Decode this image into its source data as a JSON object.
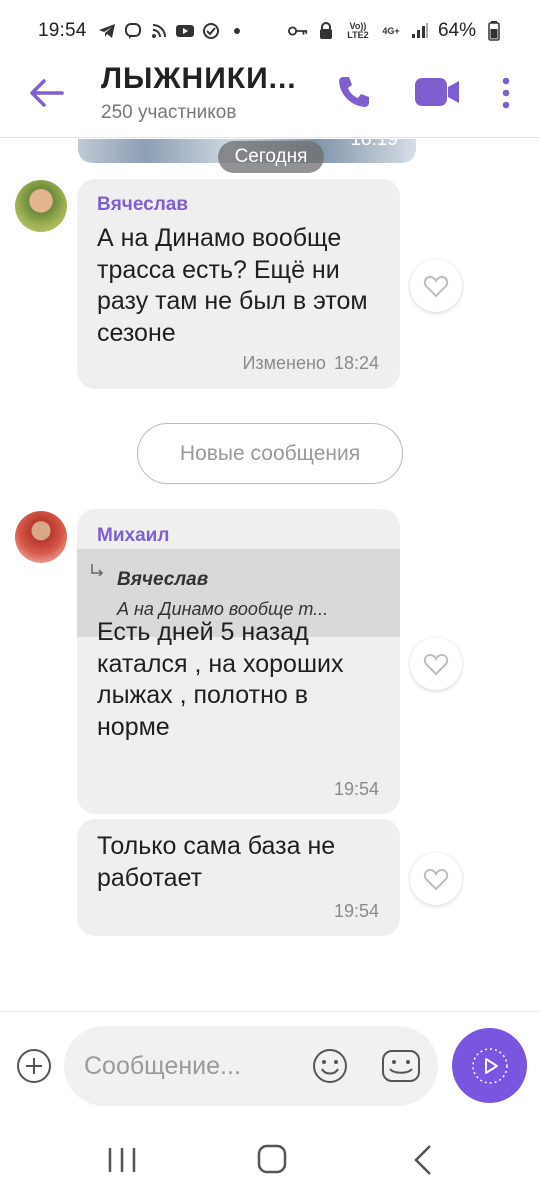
{
  "status_bar": {
    "time": "19:54",
    "volte_label": "Vo)) LTE2",
    "net_label": "4G+",
    "battery": "64%",
    "icons": [
      "telegram-icon",
      "viber-icon",
      "rss-icon",
      "youtube-icon",
      "check-circle-icon",
      "dot-icon",
      "key-icon",
      "lock-icon",
      "signal-icon"
    ]
  },
  "header": {
    "title": "ЛЫЖНИКИ...",
    "subtitle": "250 участников",
    "accent": "#7f5fcf"
  },
  "chat": {
    "date_pill": "Сегодня",
    "prev_photo_time": "18:19",
    "new_messages_label": "Новые сообщения",
    "messages": [
      {
        "sender": "Вячеслав",
        "text": "А на Динамо вообще трасса есть? Ещё ни разу там не был в этом сезоне",
        "edited_label": "Изменено",
        "time": "18:24"
      },
      {
        "sender": "Михаил",
        "quote_author": "Вячеслав",
        "quote_text": "А на Динамо вообще т...",
        "text": "Есть дней 5 назад катался , на хороших лыжах , полотно в норме",
        "time": "19:54"
      },
      {
        "text": "Только сама база не работает",
        "time": "19:54"
      }
    ]
  },
  "composer": {
    "placeholder": "Сообщение..."
  }
}
